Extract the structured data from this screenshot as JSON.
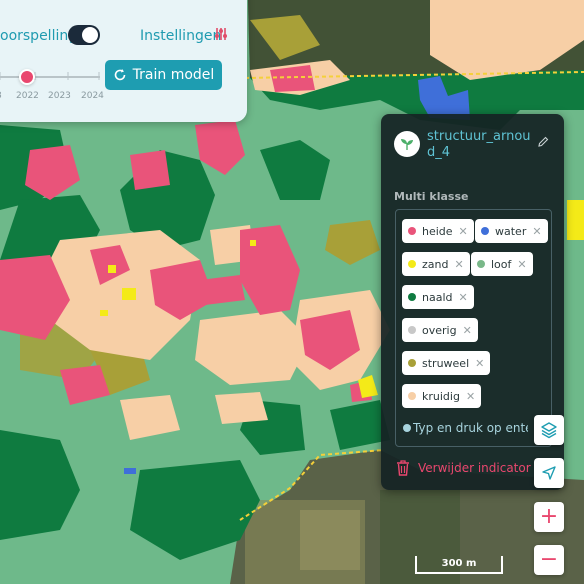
{
  "top_panel": {
    "toggle_label": "oorspelling",
    "settings_label": "Instellingen",
    "year_partial": "8",
    "years": [
      "2022",
      "2023",
      "2024"
    ],
    "train_button": "Train model",
    "forecast_enabled": true
  },
  "indicator_panel": {
    "title": "structuur_arnoud_4",
    "section_label": "Multi klasse",
    "chips": [
      {
        "label": "heide",
        "color": "#e9547a"
      },
      {
        "label": "water",
        "color": "#3f6fd9"
      },
      {
        "label": "zand",
        "color": "#f4ea18"
      },
      {
        "label": "loof",
        "color": "#79b889"
      },
      {
        "label": "naald",
        "color": "#0f7b40"
      },
      {
        "label": "overig",
        "color": "#c8c8c8"
      },
      {
        "label": "struweel",
        "color": "#a8a038"
      },
      {
        "label": "kruidig",
        "color": "#f7cfa6"
      }
    ],
    "input_placeholder": "Typ en druk op enter",
    "delete_label": "Verwijder indicator"
  },
  "map_controls": {
    "zoom_in": "+",
    "zoom_out": "−",
    "scale_label": "300 m",
    "layers_icon": "layers-icon",
    "locate_icon": "navigation-icon"
  },
  "colors": {
    "accent": "#1e9db1",
    "accent_dark": "#1b2a3a",
    "danger": "#e9476e",
    "heide": "#e9547a",
    "loof": "#79b889",
    "naald": "#0f7b40",
    "kruidig": "#f7cfa6",
    "zand": "#f4ea18",
    "water": "#3f6fd9"
  }
}
